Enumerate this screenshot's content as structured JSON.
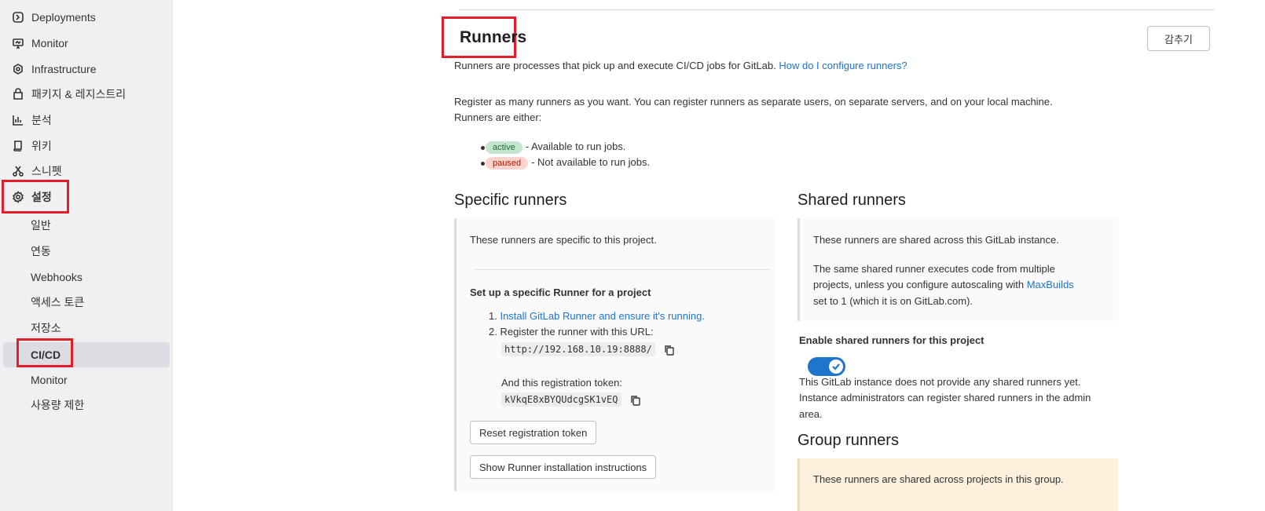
{
  "sidebar": {
    "items": [
      {
        "label": "Deployments",
        "icon": "deployments-icon"
      },
      {
        "label": "Monitor",
        "icon": "monitor-icon"
      },
      {
        "label": "Infrastructure",
        "icon": "infrastructure-icon"
      },
      {
        "label": "패키지 & 레지스트리",
        "icon": "package-icon"
      },
      {
        "label": "분석",
        "icon": "analytics-icon"
      },
      {
        "label": "위키",
        "icon": "book-icon"
      },
      {
        "label": "스니펫",
        "icon": "snippet-icon"
      },
      {
        "label": "설정",
        "icon": "gear-icon"
      }
    ],
    "sub_items": [
      "일반",
      "연동",
      "Webhooks",
      "액세스 토큰",
      "저장소",
      "CI/CD",
      "Monitor",
      "사용량 제한"
    ]
  },
  "runners": {
    "title": "Runners",
    "collapse_label": "감추기",
    "intro": "Runners are processes that pick up and execute CI/CD jobs for GitLab.",
    "intro_link": "How do I configure runners?",
    "register_line1": "Register as many runners as you want. You can register runners as separate users, on separate servers, and on your local machine.",
    "register_line2": "Runners are either:",
    "status_active": {
      "badge": "active",
      "text": "- Available to run jobs."
    },
    "status_paused": {
      "badge": "paused",
      "text": "- Not available to run jobs."
    }
  },
  "specific": {
    "title": "Specific runners",
    "desc": "These runners are specific to this project.",
    "setup_title": "Set up a specific Runner for a project",
    "step1_num": "1.",
    "step1_link": "Install GitLab Runner and ensure it's running.",
    "step2_num": "2.",
    "step2_text": "Register the runner with this URL:",
    "url": "http://192.168.10.19:8888/",
    "token_label": "And this registration token:",
    "token": "kVkqE8xBYQUdcgSK1vEQ",
    "reset_button": "Reset registration token",
    "show_button": "Show Runner installation instructions"
  },
  "shared": {
    "title": "Shared runners",
    "desc": "These runners are shared across this GitLab instance.",
    "desc2_line1": "The same shared runner executes code from multiple",
    "desc2_line2_pre": "projects, unless you configure autoscaling with",
    "desc2_link": "MaxBuilds",
    "desc2_line3": "set to 1 (which it is on GitLab.com).",
    "enable_label": "Enable shared runners for this project",
    "toggle_on": true,
    "note_line1": "This GitLab instance does not provide any shared runners yet.",
    "note_line2": "Instance administrators can register shared runners in the admin",
    "note_line3": "area."
  },
  "group": {
    "title": "Group runners",
    "desc": "These runners are shared across projects in this group."
  },
  "colors": {
    "accent": "#1f75cb",
    "highlight": "#e01f2a"
  }
}
